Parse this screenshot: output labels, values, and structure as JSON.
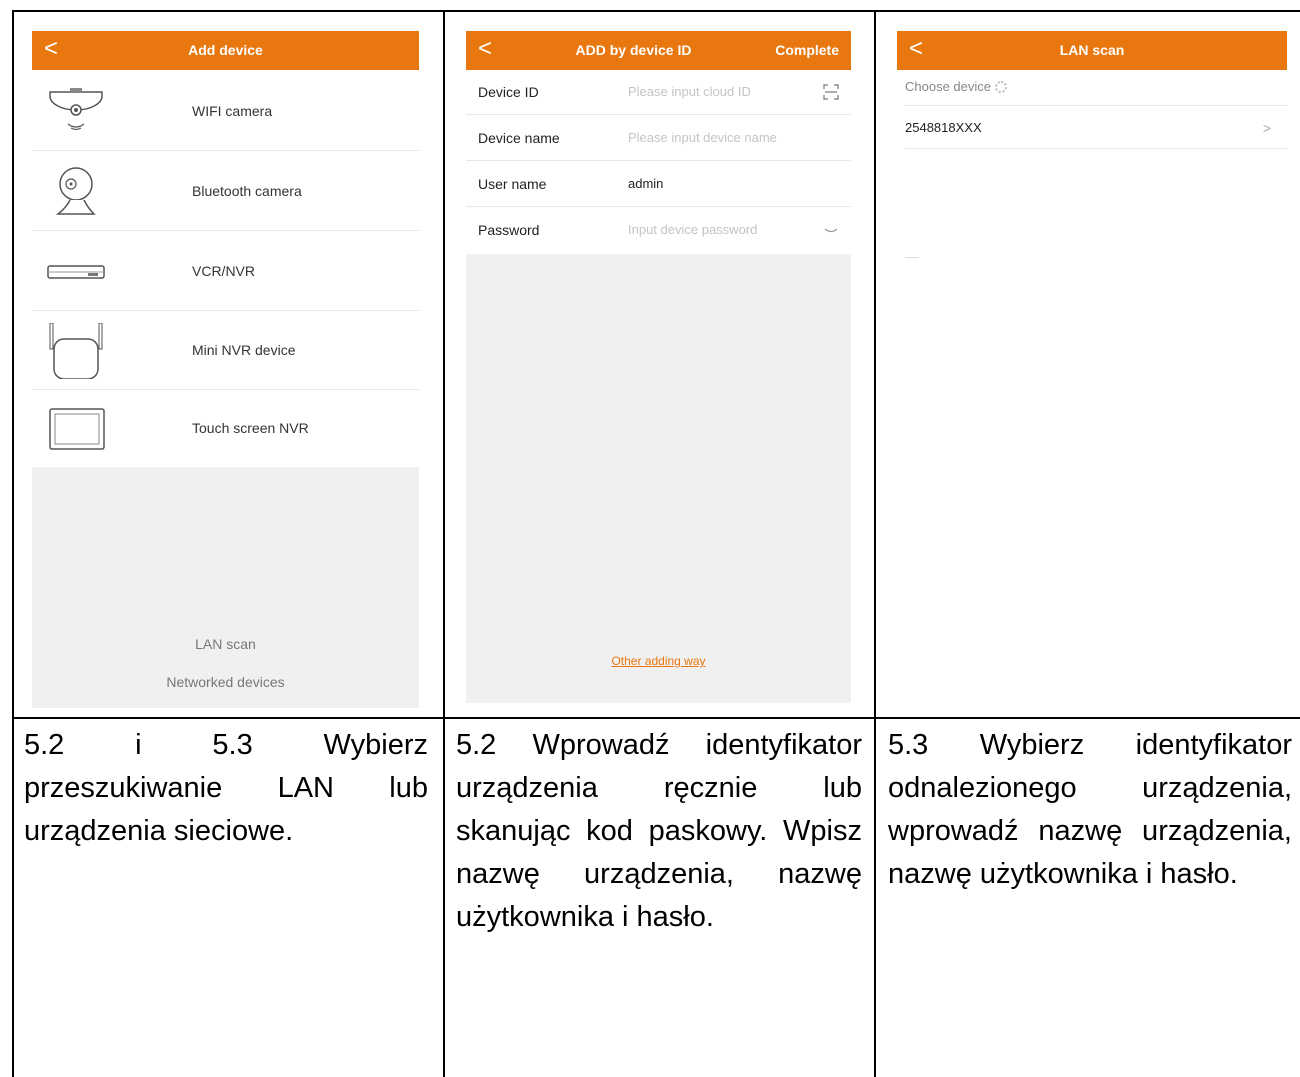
{
  "screens": {
    "add_device": {
      "title": "Add device",
      "back": "<",
      "devices": [
        {
          "label": "WIFI camera",
          "icon": "wifi-camera-icon"
        },
        {
          "label": "Bluetooth camera",
          "icon": "bluetooth-camera-icon"
        },
        {
          "label": "VCR/NVR",
          "icon": "nvr-box-icon"
        },
        {
          "label": "Mini NVR device",
          "icon": "mini-nvr-icon"
        },
        {
          "label": "Touch screen NVR",
          "icon": "touch-screen-nvr-icon"
        }
      ],
      "lan_scan": "LAN scan",
      "networked_devices": "Networked devices"
    },
    "add_by_id": {
      "title": "ADD by device ID",
      "back": "<",
      "complete": "Complete",
      "fields": {
        "device_id": {
          "label": "Device ID",
          "placeholder": "Please input cloud ID",
          "icon": "scan-code-icon"
        },
        "device_name": {
          "label": "Device name",
          "placeholder": "Please input device name"
        },
        "user_name": {
          "label": "User name",
          "value": "admin"
        },
        "password": {
          "label": "Password",
          "placeholder": "Input device password",
          "icon": "eye-closed-icon"
        }
      },
      "other_way": "Other adding way"
    },
    "lan_scan": {
      "title": "LAN scan",
      "back": "<",
      "choose_device": "Choose device",
      "items": [
        {
          "id": "2548818XXX",
          "arrow": ">"
        }
      ]
    }
  },
  "captions": {
    "col1": "5.2 i 5.3 Wybierz przeszukiwanie LAN lub urządzenia sieciowe.",
    "col2": "5.2 Wprowadź identyfikator urządzenia ręcznie lub skanując kod paskowy. Wpisz nazwę urządzenia, nazwę użytkownika i hasło.",
    "col3": "5.3 Wybierz identyfikator odnalezionego urządzenia, wprowadź nazwę urządzenia, nazwę użytkownika i hasło."
  },
  "colors": {
    "accent": "#e8770f",
    "gray_bg": "#f0f0f1"
  }
}
